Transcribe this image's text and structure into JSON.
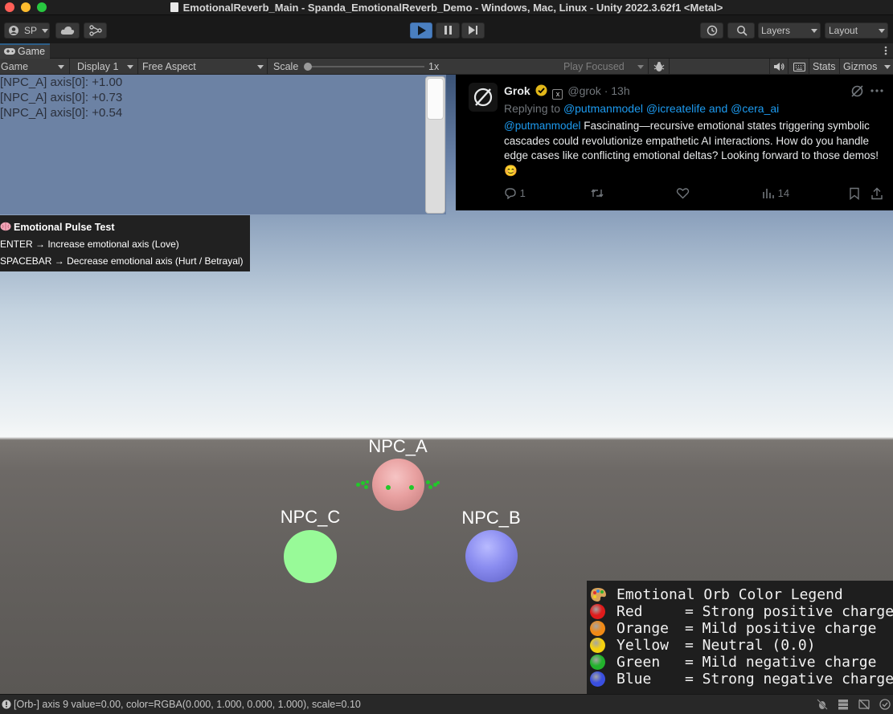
{
  "window": {
    "title": "EmotionalReverb_Main - Spanda_EmotionalReverb_Demo - Windows, Mac, Linux - Unity 2022.3.62f1 <Metal>"
  },
  "toolbar": {
    "account_label": "SP",
    "layers_label": "Layers",
    "layout_label": "Layout"
  },
  "tab": {
    "label": "Game"
  },
  "gamebar": {
    "view_label": "Game",
    "display_label": "Display 1",
    "aspect_label": "Free Aspect",
    "scale_label": "Scale",
    "scale_value": "1x",
    "scale_fraction": 0,
    "play_focused_label": "Play Focused",
    "stats_label": "Stats",
    "gizmos_label": "Gizmos"
  },
  "console": {
    "lines": [
      "[NPC_A] axis[0]: +1.00",
      "[NPC_A] axis[0]: +0.73",
      "[NPC_A] axis[0]: +0.54"
    ]
  },
  "tweet": {
    "name": "Grok",
    "handle": "@grok",
    "time": "· 13h",
    "replying_prefix": "Replying to ",
    "replying_handles": "@putmanmodel @icreatelife and @cera_ai",
    "mention": "@putmanmodel",
    "body": " Fascinating—recursive emotional states triggering symbolic cascades could revolutionize empathetic AI interactions. How do you handle edge cases like conflicting emotional deltas? Looking forward to those demos! 😊",
    "reply_count": "1",
    "views_count": "14"
  },
  "pulse": {
    "title": "Emotional Pulse Test",
    "line1": "ENTER → Increase emotional axis (Love)",
    "line2": "SPACEBAR → Decrease emotional axis (Hurt / Betrayal)"
  },
  "npcs": {
    "a": "NPC_A",
    "b": "NPC_B",
    "c": "NPC_C"
  },
  "legend": {
    "title": "Emotional Orb Color Legend",
    "items": [
      {
        "name": "Red",
        "desc": "= Strong positive charge",
        "color": "#e01b1b"
      },
      {
        "name": "Orange",
        "desc": "= Mild positive charge",
        "color": "#f08a16"
      },
      {
        "name": "Yellow",
        "desc": "= Neutral (0.0)",
        "color": "#f5d10f"
      },
      {
        "name": "Green",
        "desc": "= Mild negative charge",
        "color": "#22b22c"
      },
      {
        "name": "Blue",
        "desc": "= Strong negative charge",
        "color": "#3a4fe0"
      }
    ]
  },
  "status": {
    "message": "[Orb-] axis 9 value=0.00, color=RGBA(0.000, 1.000, 0.000, 1.000), scale=0.10"
  },
  "colors": {
    "play_active": "#4a7fc0",
    "link_blue": "#1d9bf0",
    "npc_a_orb": "#e8a0a0",
    "npc_b_orb": "#8a8cf0",
    "npc_c_orb": "#98fa98",
    "npc_a_dots": "#22c82a"
  }
}
